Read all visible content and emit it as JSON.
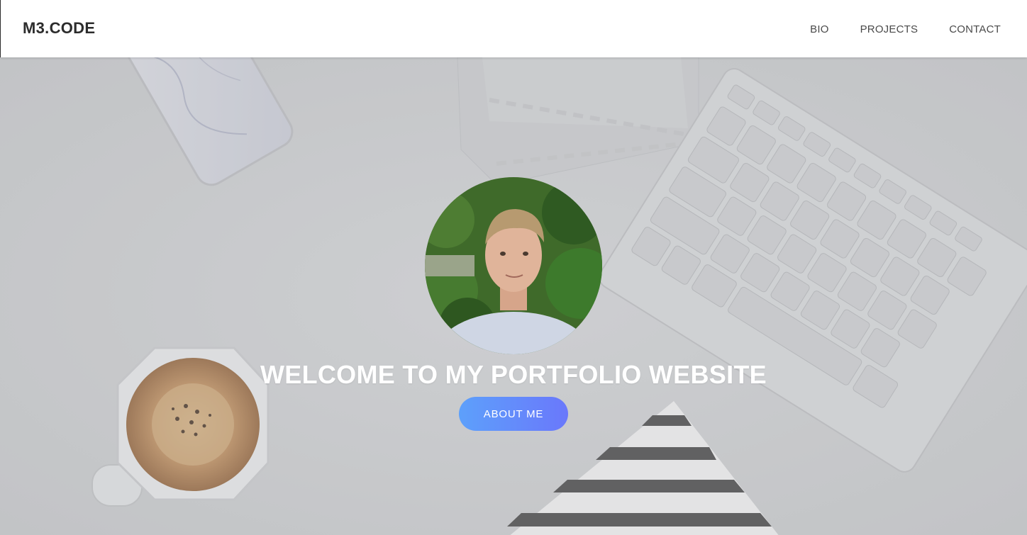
{
  "navbar": {
    "brand": "M3.CODE",
    "links": [
      {
        "label": "BIO"
      },
      {
        "label": "PROJECTS"
      },
      {
        "label": "CONTACT"
      }
    ]
  },
  "hero": {
    "title": "WELCOME TO MY PORTFOLIO WEBSITE",
    "button_label": "ABOUT ME",
    "avatar": "profile-photo"
  },
  "colors": {
    "button_gradient_start": "#5da0fb",
    "button_gradient_end": "#6a78fb",
    "hero_overlay": "#c7c9cb",
    "brand_text": "#2c2c2c"
  }
}
